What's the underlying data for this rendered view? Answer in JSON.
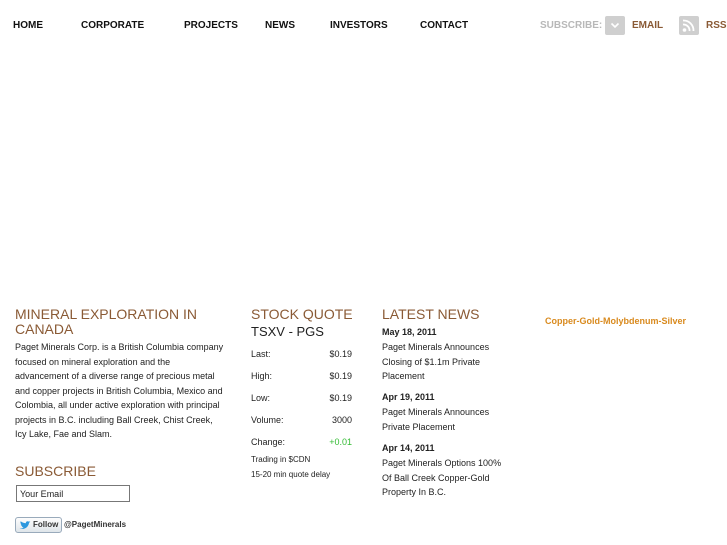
{
  "nav": {
    "items": [
      "HOME",
      "CORPORATE",
      "PROJECTS",
      "NEWS",
      "INVESTORS",
      "CONTACT"
    ],
    "subscribe_label": "SUBSCRIBE:",
    "email_label": "EMAIL",
    "rss_label": "RSS"
  },
  "about": {
    "title": "MINERAL EXPLORATION IN CANADA",
    "body": "Paget Minerals Corp. is a British Columbia company focused on mineral exploration and the advancement of a diverse range of precious metal and copper projects in British Columbia, Mexico and Colombia, all under active exploration with principal projects in B.C. including Ball Creek, Chist Creek, Icy Lake, Fae and Slam."
  },
  "subscribe": {
    "title": "SUBSCRIBE",
    "input_value": "Your Email"
  },
  "twitter": {
    "follow_label": "Follow",
    "handle": "@PagetMinerals"
  },
  "stock": {
    "title": "STOCK QUOTE",
    "symbol": "TSXV - PGS",
    "rows": [
      {
        "label": "Last:",
        "value": "$0.19"
      },
      {
        "label": "High:",
        "value": "$0.19"
      },
      {
        "label": "Low:",
        "value": "$0.19"
      },
      {
        "label": "Volume:",
        "value": "3000"
      },
      {
        "label": "Change:",
        "value": "+0.01"
      }
    ],
    "note1": "Trading in $CDN",
    "note2": "15-20 min quote delay"
  },
  "news": {
    "title": "LATEST NEWS",
    "items": [
      {
        "date": "May 18, 2011",
        "title": "Paget Minerals Announces Closing of $1.1m Private Placement"
      },
      {
        "date": "Apr 19, 2011",
        "title": "Paget Minerals Announces Private Placement"
      },
      {
        "date": "Apr 14, 2011",
        "title": "Paget Minerals Options 100% Of Ball Creek Copper-Gold Property In B.C."
      }
    ]
  },
  "tagline": "Copper-Gold-Molybdenum-Silver",
  "colors": {
    "accent_brown": "#8a5a35",
    "accent_orange": "#d98a1e",
    "change_green": "#33bb33"
  }
}
